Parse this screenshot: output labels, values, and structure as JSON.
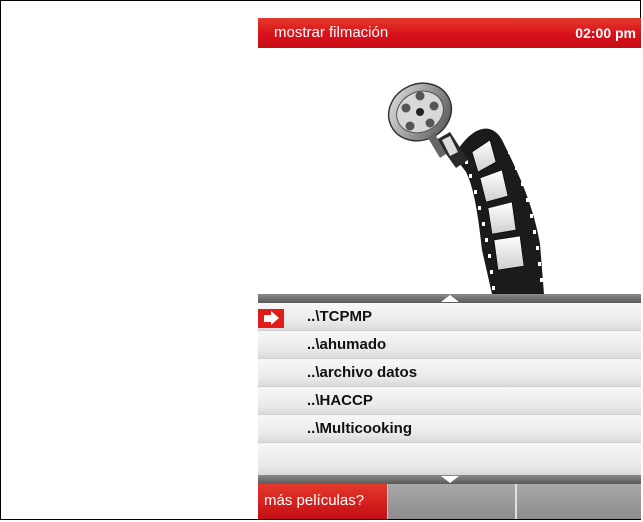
{
  "header": {
    "title": "mostrar filmación",
    "clock": "02:00 pm",
    "accent": "#d8111a"
  },
  "hero": {
    "icon": "film-reel-icon"
  },
  "list": {
    "items": [
      {
        "label": "..\\TCPMP",
        "selected": true
      },
      {
        "label": "..\\ahumado",
        "selected": false
      },
      {
        "label": "..\\archivo  datos",
        "selected": false
      },
      {
        "label": "..\\HACCP",
        "selected": false
      },
      {
        "label": "..\\Multicooking",
        "selected": false
      }
    ]
  },
  "footer": {
    "more_label": "más películas?"
  }
}
